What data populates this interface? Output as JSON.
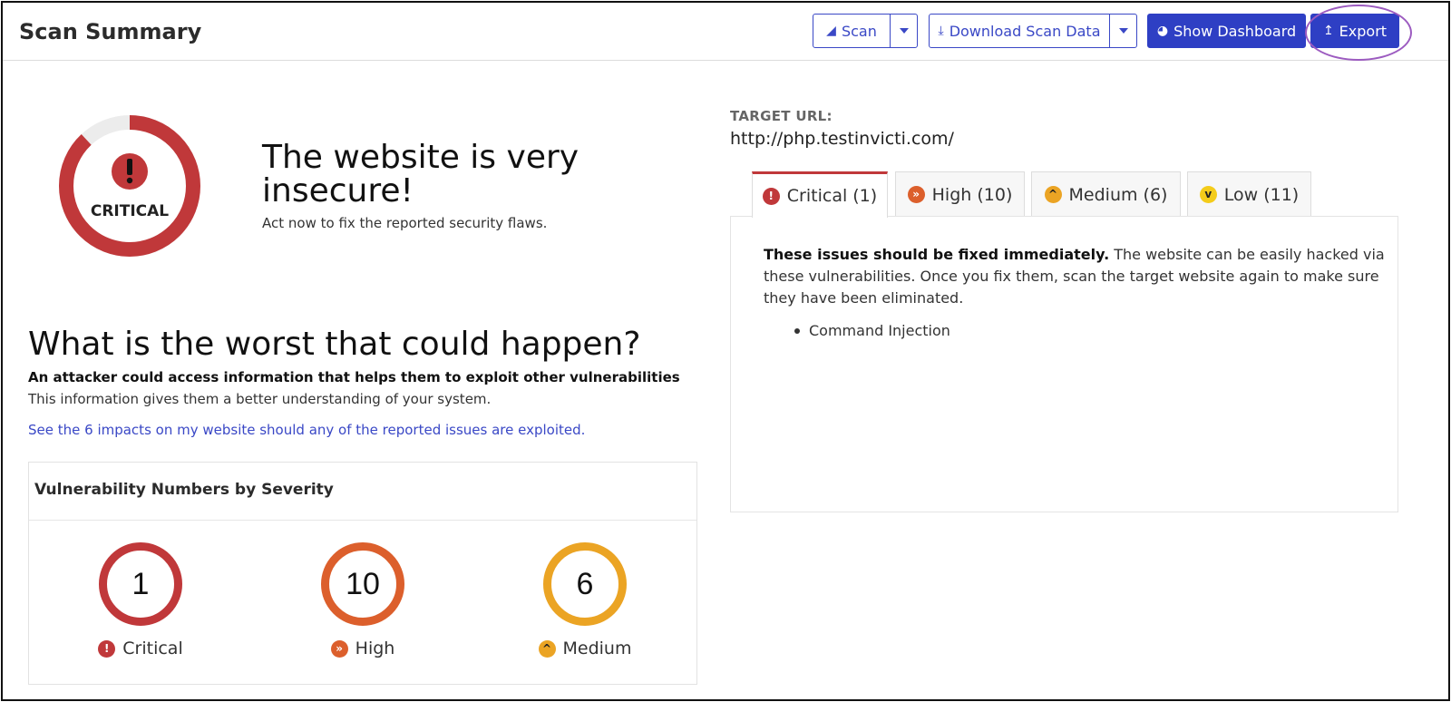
{
  "header": {
    "title": "Scan Summary",
    "scan_label": "Scan",
    "download_label": "Download Scan Data",
    "dashboard_label": "Show Dashboard",
    "export_label": "Export"
  },
  "hero": {
    "gauge_label": "CRITICAL",
    "gauge_fill_fraction": 0.88,
    "title_line1": "The website is very",
    "title_line2": "insecure!",
    "subtitle": "Act now to fix the reported security flaws."
  },
  "worst": {
    "title": "What is the worst that could happen?",
    "bold_text": "An attacker could access information that helps them to exploit other vulnerabilities",
    "sub_text": "This information gives them a better understanding of your system.",
    "link_text": "See the 6 impacts on my website should any of the reported issues are exploited."
  },
  "vuln_numbers": {
    "title": "Vulnerability Numbers by Severity",
    "items": [
      {
        "label": "Critical",
        "count": "1",
        "color": "#c0383a"
      },
      {
        "label": "High",
        "count": "10",
        "color": "#dc5f2c"
      },
      {
        "label": "Medium",
        "count": "6",
        "color": "#eba424"
      }
    ]
  },
  "target": {
    "label": "TARGET URL:",
    "url": "http://php.testinvicti.com/"
  },
  "tabs": [
    {
      "label": "Critical (1)",
      "color": "#c0383a"
    },
    {
      "label": "High (10)",
      "color": "#dc5f2c"
    },
    {
      "label": "Medium (6)",
      "color": "#eba424"
    },
    {
      "label": "Low (11)",
      "color": "#f4cc1a"
    }
  ],
  "panel": {
    "bold_lead": "These issues should be fixed immediately.",
    "text": " The website can be easily hacked via these vulnerabilities. Once you fix them, scan the target website again to make sure they have been eliminated.",
    "issues": [
      "Command Injection"
    ]
  },
  "colors": {
    "accent": "#2e3fc4",
    "critical": "#c0383a",
    "export_highlight": "#9c5bc0"
  }
}
